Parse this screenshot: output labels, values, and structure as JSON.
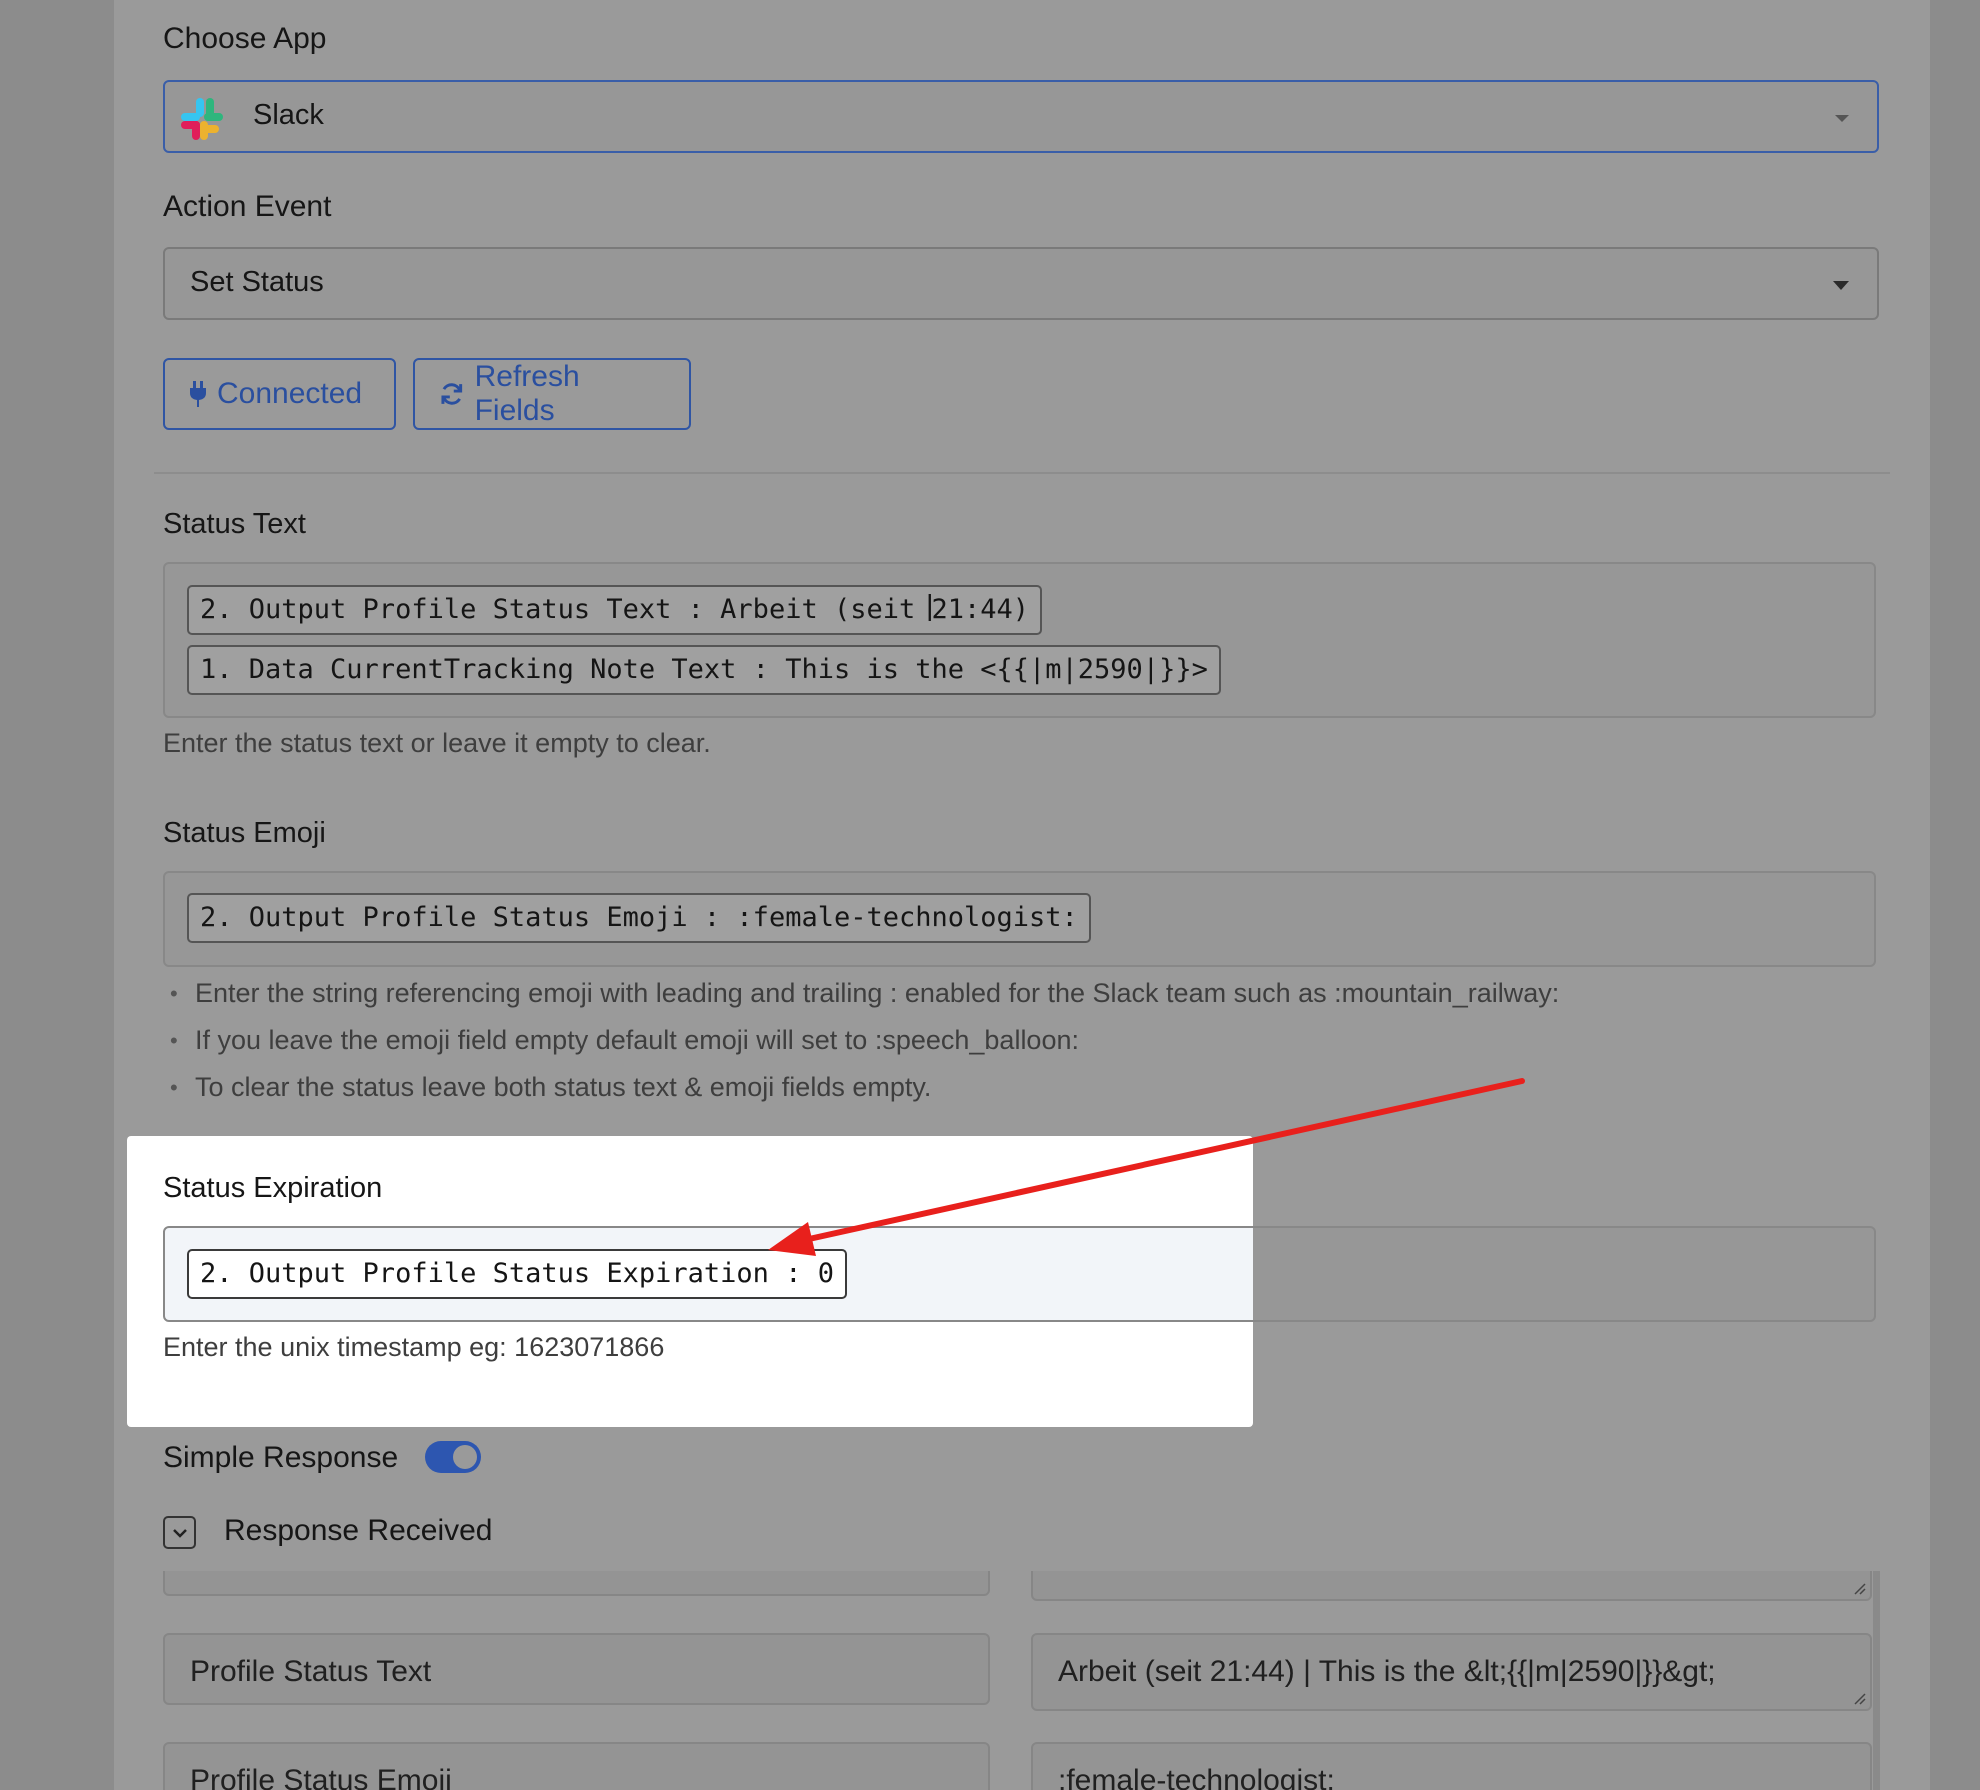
{
  "choose_app": {
    "label": "Choose App",
    "value": "Slack",
    "icon": "slack-logo-icon"
  },
  "action_event": {
    "label": "Action Event",
    "value": "Set Status"
  },
  "buttons": {
    "connected": "Connected",
    "refresh": "Refresh Fields"
  },
  "status_text": {
    "label": "Status Text",
    "chips": [
      "2. Output Profile Status Text : Arbeit (seit 21:44)",
      "1. Data CurrentTracking Note Text : This is the <{{|m|2590|}}>"
    ],
    "separator": "|",
    "hint": "Enter the status text or leave it empty to clear."
  },
  "status_emoji": {
    "label": "Status Emoji",
    "chip": "2. Output Profile Status Emoji : :female-technologist:",
    "bullets": [
      "Enter the string referencing emoji with leading and trailing : enabled for the Slack team such as :mountain_railway:",
      "If you leave the emoji field empty default emoji will set to :speech_balloon:",
      "To clear the status leave both status text & emoji fields empty."
    ]
  },
  "status_expiration": {
    "label": "Status Expiration",
    "chip": "2. Output Profile Status Expiration : 0",
    "hint": "Enter the unix timestamp eg: 1623071866"
  },
  "simple_response": {
    "label": "Simple Response",
    "enabled": true
  },
  "response_received": {
    "label": "Response Received",
    "rows": [
      {
        "key": "Profile Status Text",
        "value": "Arbeit (seit 21:44) | This is the &lt;{{|m|2590|}}&gt;"
      },
      {
        "key": "Profile Status Emoji",
        "value": ":female-technologist:"
      }
    ]
  },
  "colors": {
    "accent": "#2d56b0",
    "annotation_arrow": "#e8201c",
    "highlight": "#ffffff"
  }
}
